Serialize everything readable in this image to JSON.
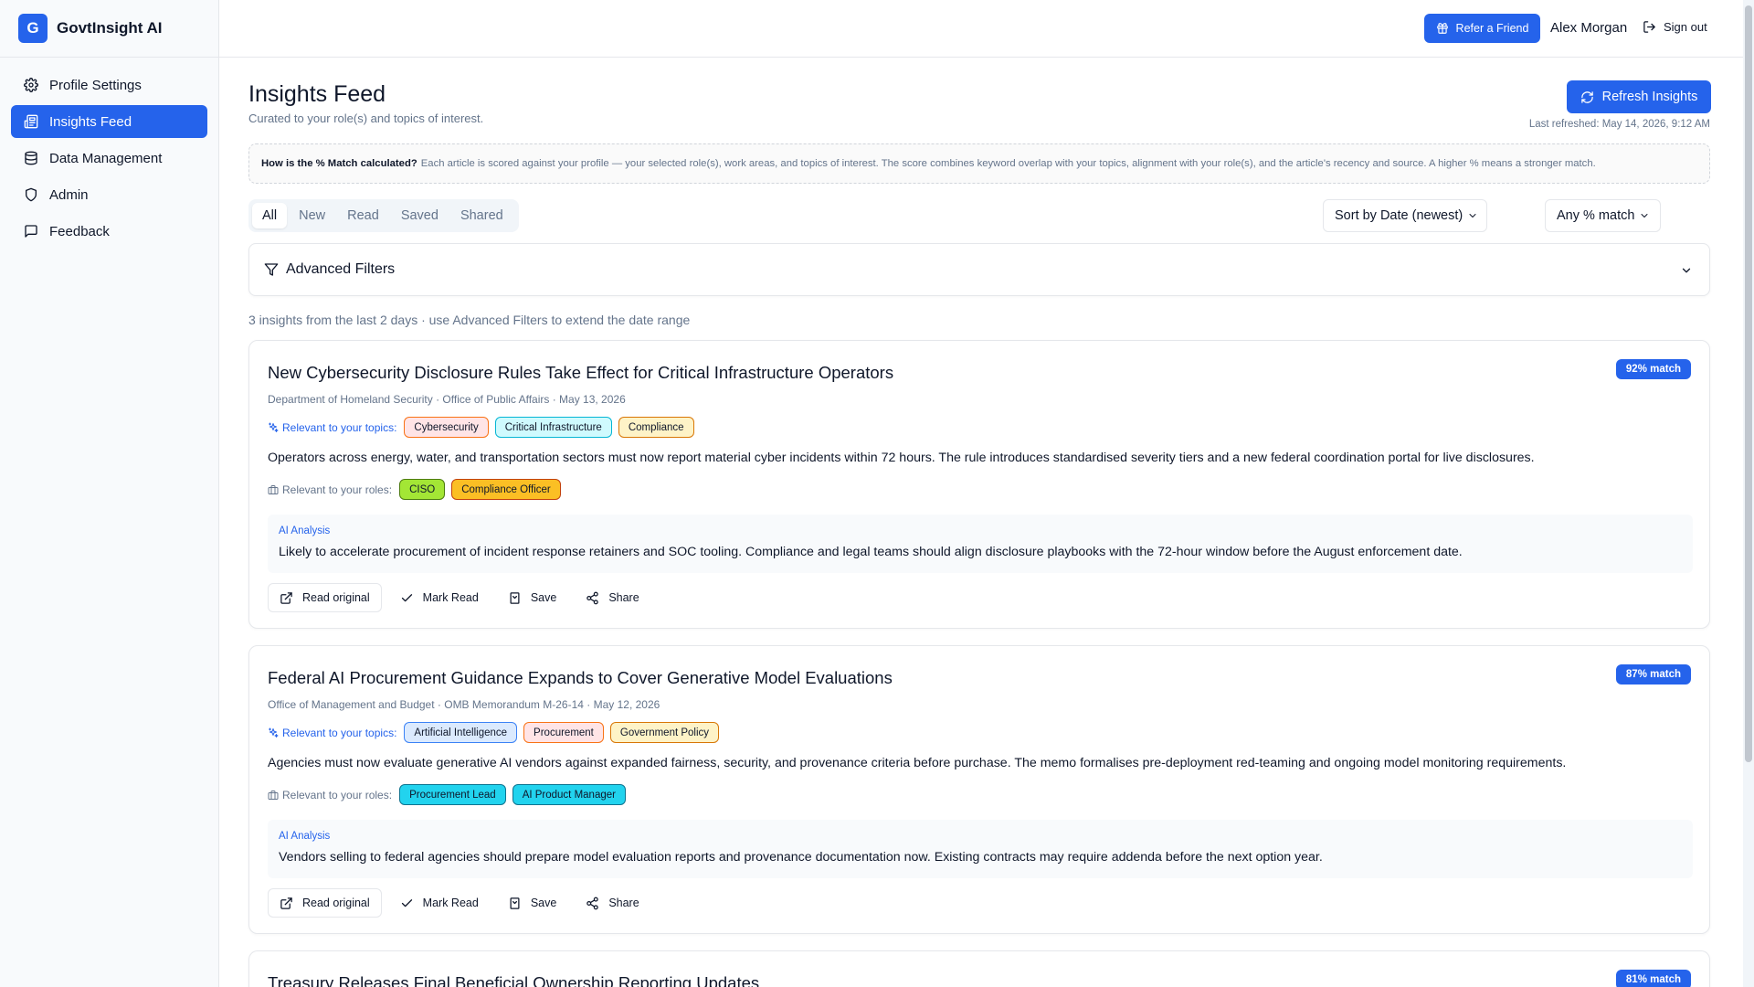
{
  "brand": {
    "logo_letter": "G",
    "name": "GovtInsight AI"
  },
  "sidebar": {
    "items": [
      {
        "label": "Profile Settings",
        "icon": "gear-icon",
        "active": false
      },
      {
        "label": "Insights Feed",
        "icon": "newspaper-icon",
        "active": true
      },
      {
        "label": "Data Management",
        "icon": "database-icon",
        "active": false
      },
      {
        "label": "Admin",
        "icon": "shield-icon",
        "active": false
      },
      {
        "label": "Feedback",
        "icon": "message-icon",
        "active": false
      }
    ]
  },
  "topbar": {
    "refer_label": "Refer a Friend",
    "user_name": "Alex Morgan",
    "signout_label": "Sign out"
  },
  "header": {
    "title": "Insights Feed",
    "subtitle": "Curated to your role(s) and topics of interest.",
    "refresh_label": "Refresh Insights",
    "last_refreshed": "Last refreshed: May 14, 2026, 9:12 AM"
  },
  "info": {
    "question": "How is the % Match calculated?",
    "text": "Each article is scored against your profile — your selected role(s), work areas, and topics of interest. The score combines keyword overlap with your topics, alignment with your role(s), and the article's recency and source. A higher % means a stronger match."
  },
  "tabs": [
    {
      "label": "All",
      "active": true
    },
    {
      "label": "New",
      "active": false
    },
    {
      "label": "Read",
      "active": false
    },
    {
      "label": "Saved",
      "active": false
    },
    {
      "label": "Shared",
      "active": false
    }
  ],
  "sort": {
    "value": "Sort by Date (newest)"
  },
  "match_filter": {
    "value": "Any % match"
  },
  "advanced_filters_label": "Advanced Filters",
  "count_line": "3 insights from the last 2 days · use Advanced Filters to extend the date range",
  "labels": {
    "topics": "Relevant to your topics:",
    "roles": "Relevant to your roles:",
    "ai_analysis": "AI Analysis",
    "read_original": "Read original",
    "mark_read": "Mark Read",
    "save": "Save",
    "share": "Share"
  },
  "colors": {
    "accent": "#2563eb",
    "tag_orange_bg": "#fee2e2",
    "tag_orange_border": "#f97316",
    "tag_cyan_bg": "#cffafe",
    "tag_cyan_border": "#06b6d4",
    "tag_amber_bg": "#fef3c7",
    "tag_amber_border": "#d97706",
    "tag_blue_bg": "#dbeafe",
    "tag_blue_border": "#3b82f6",
    "role_green_bg": "#a3e635",
    "role_green_border": "#4d7c0f",
    "role_amber_bg": "#fbbf24",
    "role_amber_border": "#c2410c",
    "role_cyan_bg": "#22d3ee",
    "role_cyan_border": "#0e7490"
  },
  "insights": [
    {
      "title": "New Cybersecurity Disclosure Rules Take Effect for Critical Infrastructure Operators",
      "match": "92% match",
      "meta": "Department of Homeland Security · Office of Public Affairs · May 13, 2026",
      "topics": [
        {
          "label": "Cybersecurity",
          "bg": "#ffe4e6",
          "border": "#f97316"
        },
        {
          "label": "Critical Infrastructure",
          "bg": "#cffafe",
          "border": "#06b6d4"
        },
        {
          "label": "Compliance",
          "bg": "#fef3c7",
          "border": "#d97706"
        }
      ],
      "summary": "Operators across energy, water, and transportation sectors must now report material cyber incidents within 72 hours. The rule introduces standardised severity tiers and a new federal coordination portal for live disclosures.",
      "roles": [
        {
          "label": "CISO",
          "bg": "#a3e635",
          "border": "#4d7c0f"
        },
        {
          "label": "Compliance Officer",
          "bg": "#fbbf24",
          "border": "#c2410c"
        }
      ],
      "ai": "Likely to accelerate procurement of incident response retainers and SOC tooling. Compliance and legal teams should align disclosure playbooks with the 72-hour window before the August enforcement date."
    },
    {
      "title": "Federal AI Procurement Guidance Expands to Cover Generative Model Evaluations",
      "match": "87% match",
      "meta": "Office of Management and Budget · OMB Memorandum M-26-14 · May 12, 2026",
      "topics": [
        {
          "label": "Artificial Intelligence",
          "bg": "#dbeafe",
          "border": "#3b82f6"
        },
        {
          "label": "Procurement",
          "bg": "#ffe4e6",
          "border": "#f97316"
        },
        {
          "label": "Government Policy",
          "bg": "#fef3c7",
          "border": "#d97706"
        }
      ],
      "summary": "Agencies must now evaluate generative AI vendors against expanded fairness, security, and provenance criteria before purchase. The memo formalises pre-deployment red-teaming and ongoing model monitoring requirements.",
      "roles": [
        {
          "label": "Procurement Lead",
          "bg": "#22d3ee",
          "border": "#0e7490"
        },
        {
          "label": "AI Product Manager",
          "bg": "#22d3ee",
          "border": "#0e7490"
        }
      ],
      "ai": "Vendors selling to federal agencies should prepare model evaluation reports and provenance documentation now. Existing contracts may require addenda before the next option year."
    },
    {
      "title": "Treasury Releases Final Beneficial Ownership Reporting Updates",
      "match": "81% match"
    }
  ]
}
